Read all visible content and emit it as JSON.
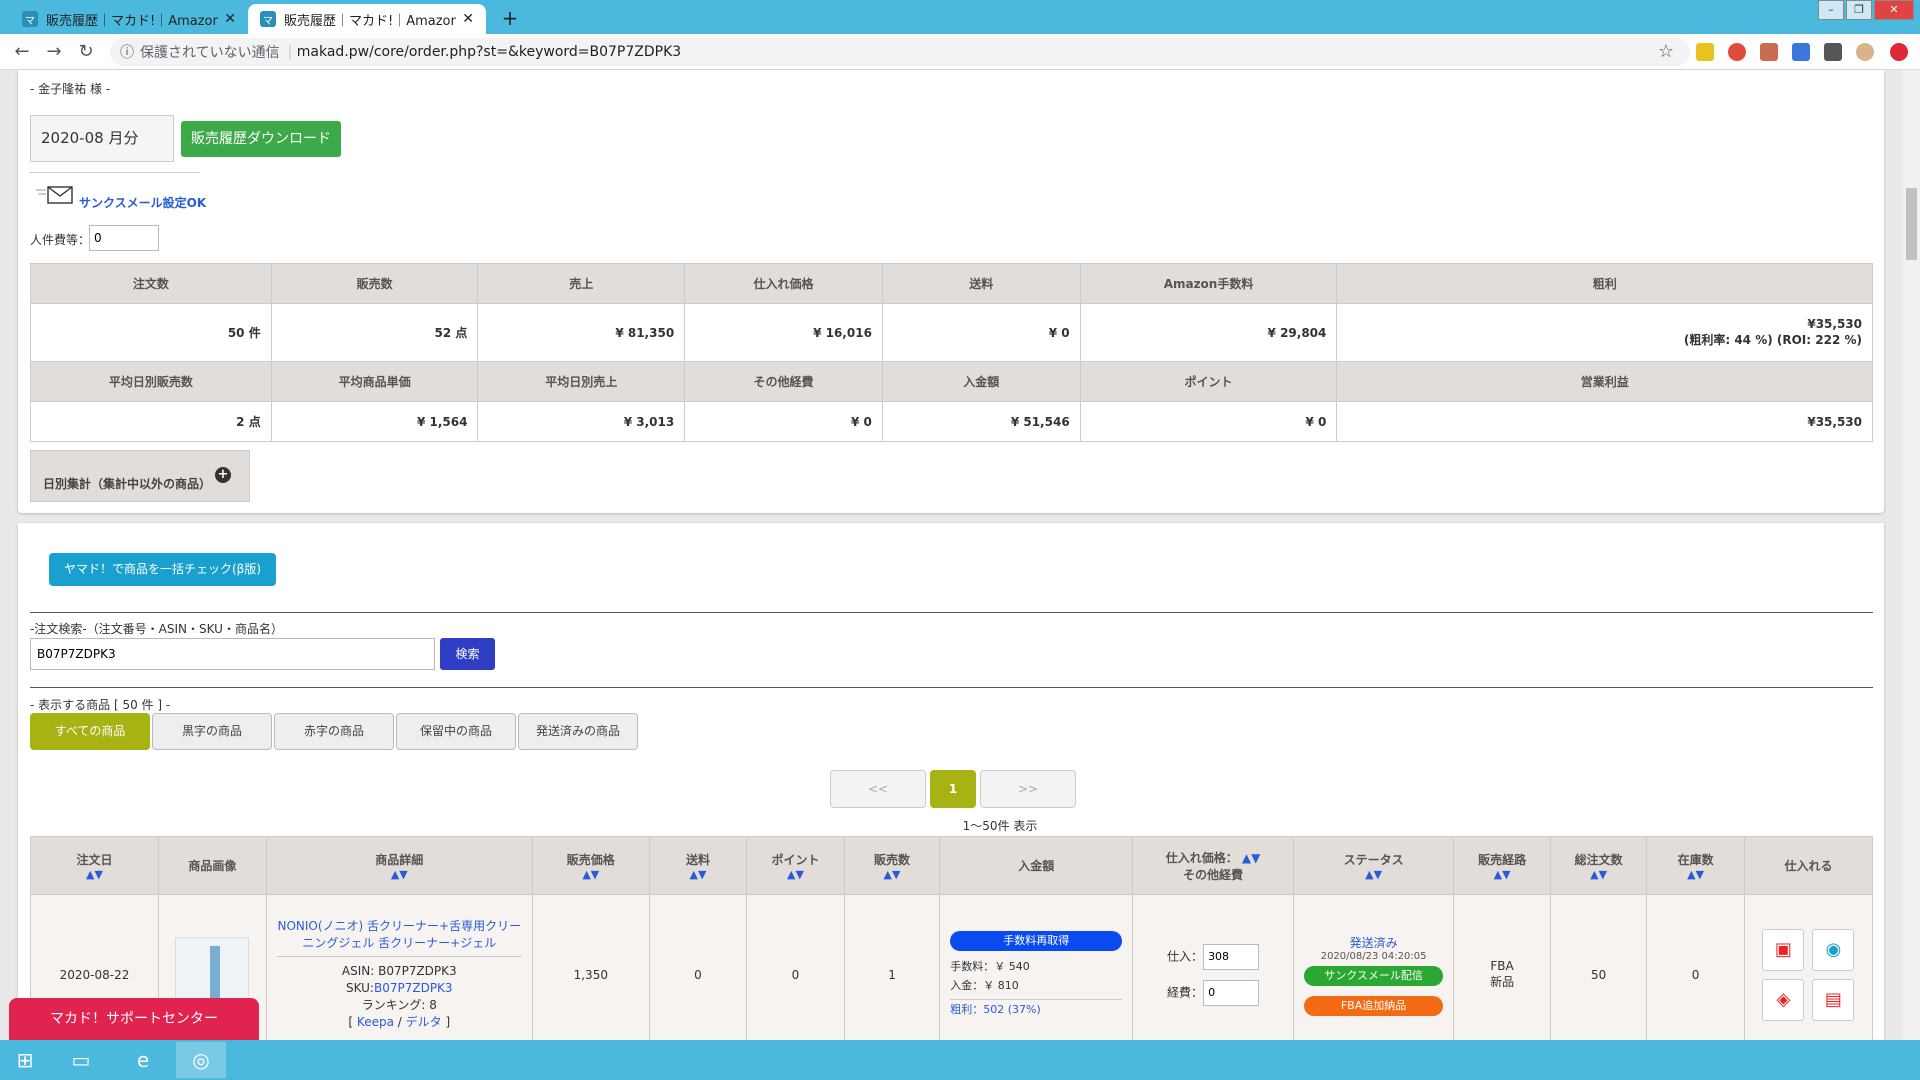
{
  "browser": {
    "tabs": [
      {
        "title": "販売履歴｜マカド!｜Amazon総合",
        "active": false
      },
      {
        "title": "販売履歴｜マカド!｜Amazon総合",
        "active": true
      }
    ],
    "insecure_label": "保護されていない通信",
    "url": "makad.pw/core/order.php?st=&keyword=B07P7ZDPK3"
  },
  "header": {
    "customer": "- 金子隆祐 様 -",
    "month": "2020-08 月分",
    "download_label": "販売履歴ダウンロード",
    "thanks_mail_label": "サンクスメール設定OK",
    "personnel_cost_label": "人件費等：",
    "personnel_cost_value": "0"
  },
  "summary": {
    "row1_headers": [
      "注文数",
      "販売数",
      "売上",
      "仕入れ価格",
      "送料",
      "Amazon手数料",
      "粗利"
    ],
    "row1_values": [
      "50 件",
      "52 点",
      "¥ 81,350",
      "¥ 16,016",
      "¥ 0",
      "¥ 29,804",
      "¥35,530"
    ],
    "gross_margin_note": "(粗利率: 44 %) (ROI: 222 %)",
    "row2_headers": [
      "平均日別販売数",
      "平均商品単価",
      "平均日別売上",
      "その他経費",
      "入金額",
      "ポイント",
      "営業利益"
    ],
    "row2_values": [
      "2 点",
      "¥ 1,564",
      "¥ 3,013",
      "¥ 0",
      "¥ 51,546",
      "¥ 0",
      "¥35,530"
    ],
    "daily_label": "日別集計（集計中以外の商品）"
  },
  "search": {
    "bulk_check_label": "ヤマド！で商品を一括チェック(β版)",
    "label": "-注文検索-（注文番号・ASIN・SKU・商品名）",
    "value": "B07P7ZDPK3",
    "button": "検索",
    "display_label": "- 表示する商品 [ 50 件 ] -",
    "filters": [
      "すべての商品",
      "黒字の商品",
      "赤字の商品",
      "保留中の商品",
      "発送済みの商品"
    ]
  },
  "pager": {
    "prev": "<<",
    "current": "1",
    "next": ">>",
    "range": "1～50件 表示"
  },
  "orders": {
    "headers": [
      "注文日",
      "商品画像",
      "商品詳細",
      "販売価格",
      "送料",
      "ポイント",
      "販売数",
      "入金額",
      "仕入れ価格：",
      "ステータス",
      "販売経路",
      "総注文数",
      "在庫数",
      "仕入れる"
    ],
    "header_sub_other": "その他経費",
    "sort_marks": "▲▼",
    "row": {
      "date": "2020-08-22",
      "name": "NONIO(ノニオ) 舌クリーナー+舌専用クリーニングジェル 舌クリーナー+ジェル",
      "asin": "ASIN: B07P7ZDPK3",
      "sku_label": "SKU:",
      "sku": "B07P7ZDPK3",
      "ranking": "ランキング: 8",
      "keepa": "Keepa",
      "delta": "デルタ",
      "price": "1,350",
      "shipping": "0",
      "points": "0",
      "qty": "1",
      "fee_badge": "手数料再取得",
      "fee": "手数料：￥ 540",
      "deposit": "入金：￥ 810",
      "gross": "粗利：502 (37%)",
      "purchase_label": "仕入：",
      "purchase_value": "308",
      "expense_label": "経費：",
      "expense_value": "0",
      "status": "発送済み",
      "status_time": "2020/08/23 04:20:05",
      "thanks_badge": "サンクスメール配信",
      "fba_badge": "FBA追加納品",
      "channel": "FBA",
      "condition": "新品",
      "total_orders": "50",
      "stock": "0"
    }
  },
  "support_label": "マカド！サポートセンター"
}
